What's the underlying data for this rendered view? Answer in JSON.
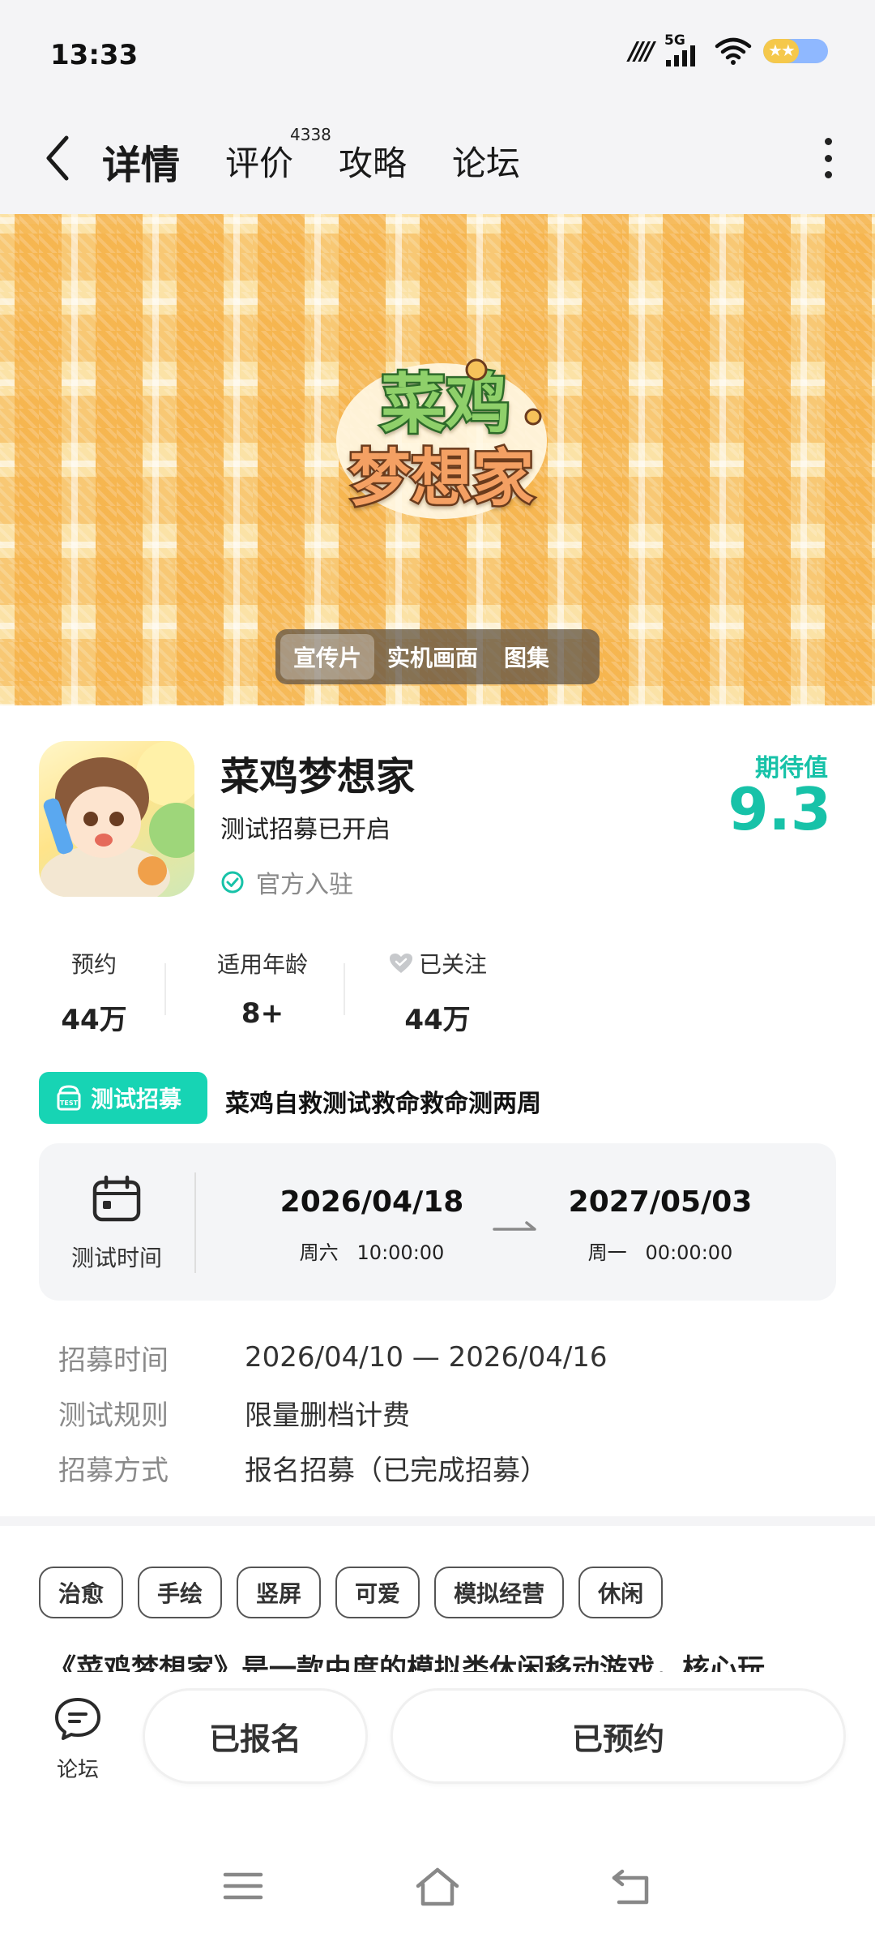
{
  "status_bar": {
    "time": "13:33",
    "network": "5G"
  },
  "nav": {
    "tabs": [
      {
        "label": "详情",
        "active": true
      },
      {
        "label": "评价",
        "badge": "4338"
      },
      {
        "label": "攻略"
      },
      {
        "label": "论坛"
      }
    ]
  },
  "banner": {
    "logo_line1": "菜鸡",
    "logo_line2": "梦想家",
    "media_tabs": [
      {
        "label": "宣传片",
        "active": true
      },
      {
        "label": "实机画面"
      },
      {
        "label": "图集"
      }
    ]
  },
  "game": {
    "title": "菜鸡梦想家",
    "subtitle": "测试招募已开启",
    "official_label": "官方入驻",
    "expect_label": "期待值",
    "expect_value": "9.3"
  },
  "stats": [
    {
      "label": "预约",
      "value": "44万"
    },
    {
      "label": "适用年龄",
      "value": "8+"
    },
    {
      "label": "已关注",
      "value": "44万"
    }
  ],
  "test": {
    "badge_label": "测试招募",
    "title": "菜鸡自救测试救命救命测两周",
    "time_label": "测试时间",
    "start_date": "2026/04/18",
    "start_sub": "周六   10:00:00",
    "end_date": "2027/05/03",
    "end_sub": "周一   00:00:00",
    "info": [
      {
        "key": "招募时间",
        "value": "2026/04/10 — 2026/04/16"
      },
      {
        "key": "测试规则",
        "value": "限量删档计费"
      },
      {
        "key": "招募方式",
        "value": "报名招募（已完成招募）"
      }
    ]
  },
  "tags": [
    "治愈",
    "手绘",
    "竖屏",
    "可爱",
    "模拟经营",
    "休闲"
  ],
  "description_peek": "《菜鸡梦想家》是一款由度的模拟类休闲移动游戏，核心玩",
  "actions": {
    "forum_label": "论坛",
    "signed_label": "已报名",
    "reserved_label": "已预约"
  },
  "colors": {
    "accent": "#17d4b4",
    "accent_text": "#17c2a8",
    "banner_bg": "#fbe2a6",
    "banner_check": "#f5b24a"
  }
}
